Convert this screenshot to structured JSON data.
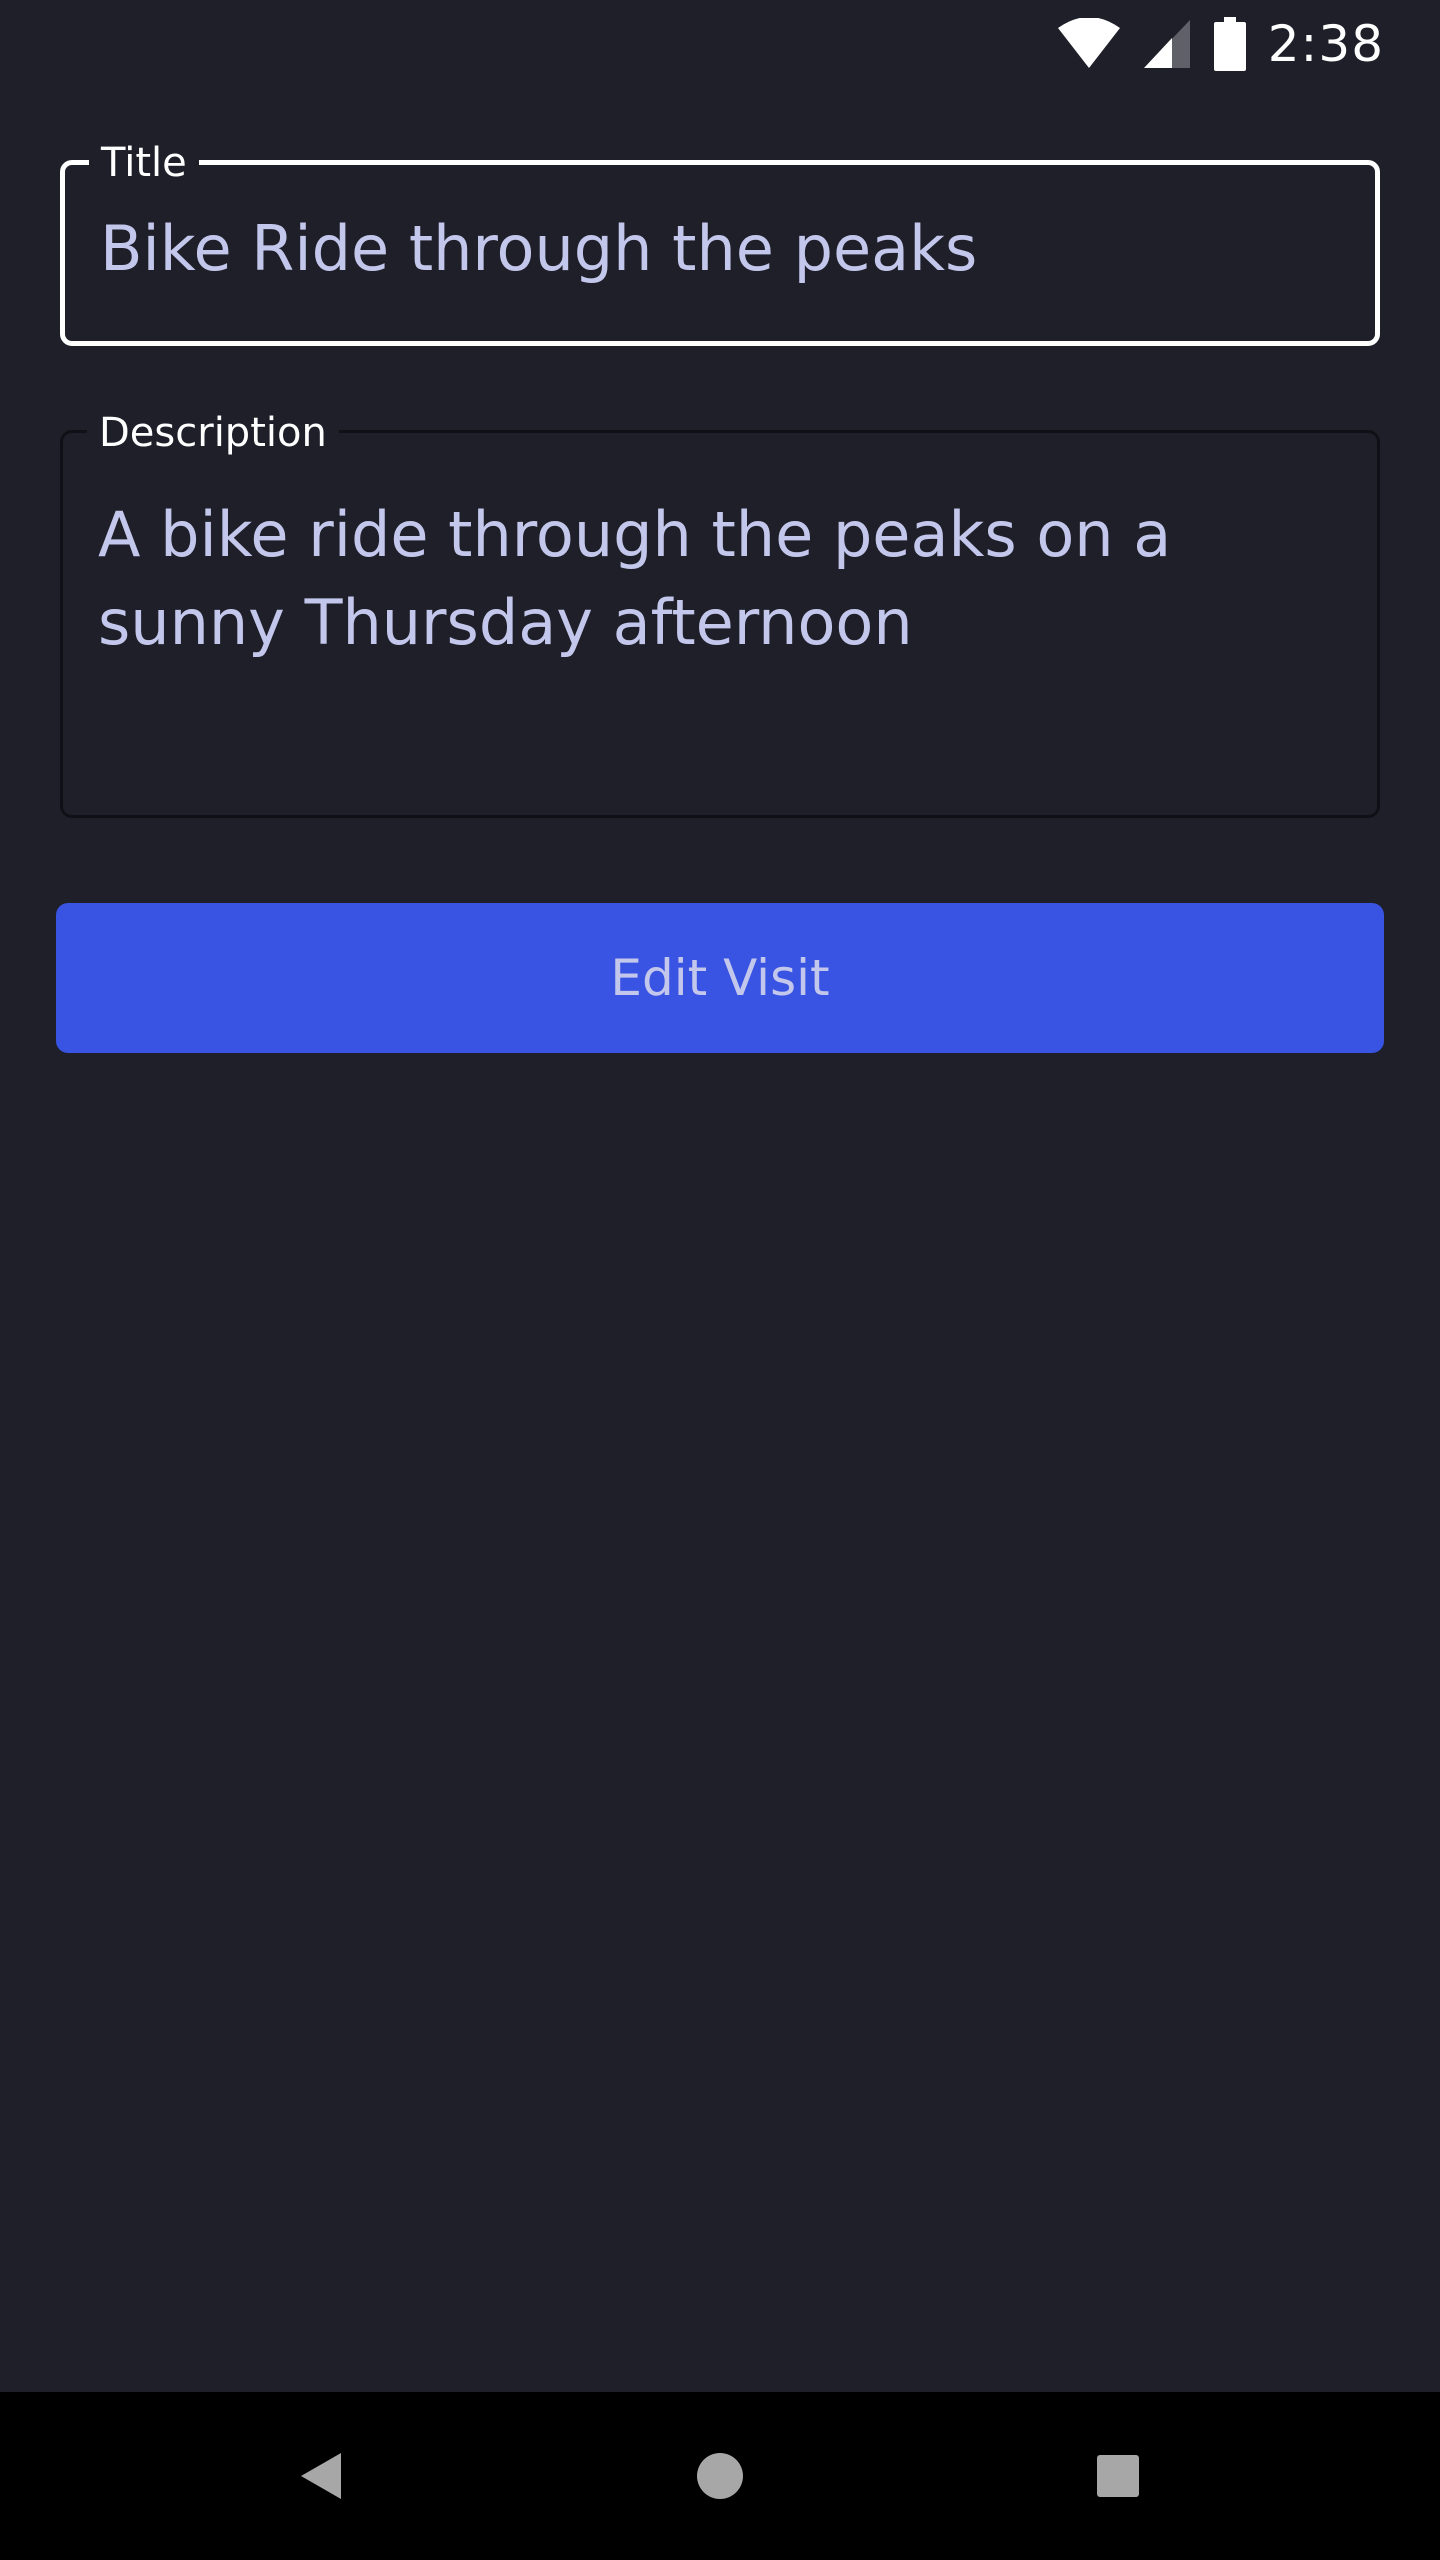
{
  "status_bar": {
    "time": "2:38",
    "icons": [
      "wifi-icon",
      "cell-signal-icon",
      "battery-icon"
    ]
  },
  "form": {
    "title": {
      "label": "Title",
      "value": "Bike Ride through the peaks"
    },
    "description": {
      "label": "Description",
      "value": "A bike ride through the peaks on a sunny Thursday afternoon"
    },
    "submit_label": "Edit Visit"
  },
  "nav_bar": {
    "buttons": [
      "back-icon",
      "home-icon",
      "recents-icon"
    ]
  },
  "colors": {
    "background": "#1e1f28",
    "accent": "#3953e3",
    "text_primary": "#ffffff",
    "text_value": "#c4c7ec"
  }
}
